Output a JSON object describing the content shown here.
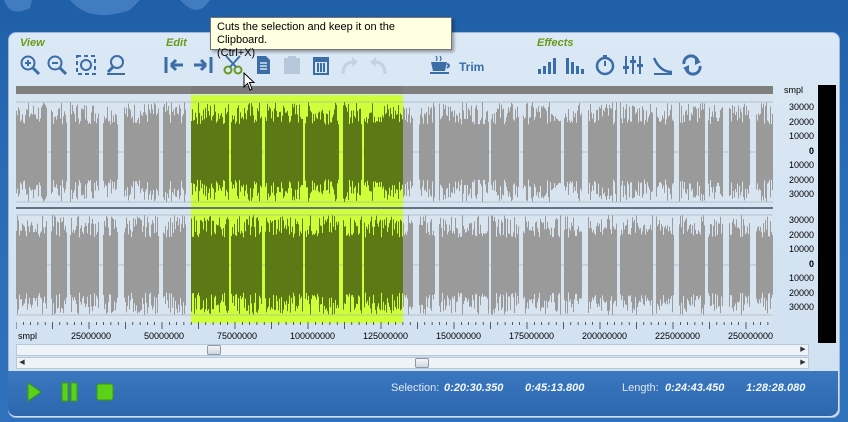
{
  "toolbar": {
    "groups": {
      "view": "View",
      "edit": "Edit",
      "effects": "Effects"
    },
    "trim_label": "Trim",
    "icons": {
      "view": [
        "zoom-in-icon",
        "zoom-out-icon",
        "zoom-fit-icon",
        "zoom-selection-icon"
      ],
      "edit": [
        "select-start-icon",
        "select-end-icon",
        "cut-icon",
        "copy-icon",
        "paste-icon",
        "delete-icon",
        "redo-icon",
        "undo-icon",
        "trim-icon"
      ],
      "effects": [
        "amplify-icon",
        "normalize-icon",
        "tempo-icon",
        "equalizer-icon",
        "fade-icon",
        "reverse-icon"
      ]
    }
  },
  "tooltip": {
    "line1": "Cuts the selection and keep it on the Clipboard.",
    "line2": "(Ctrl+X)"
  },
  "waveform": {
    "unit_label": "smpl",
    "amplitude_ticks": [
      "30000",
      "20000",
      "10000",
      "0",
      "10000",
      "20000",
      "30000"
    ],
    "time_unit_label": "smpl",
    "time_ticks": [
      "25000000",
      "50000000",
      "75000000",
      "100000000",
      "125000000",
      "150000000",
      "175000000",
      "200000000",
      "225000000",
      "250000000"
    ],
    "selection_color": "#cfff3a",
    "selection_wave_color": "#5b7a16",
    "wave_color": "#9a9a9a"
  },
  "status": {
    "selection_label": "Selection:",
    "selection_start": "0:20:30.350",
    "selection_end": "0:45:13.800",
    "length_label": "Length:",
    "length_value": "0:24:43.450",
    "total_length": "1:28:28.080"
  },
  "colors": {
    "accent": "#6a9a1a",
    "panel": "#dbe8f5",
    "play": "#5bd11a"
  }
}
